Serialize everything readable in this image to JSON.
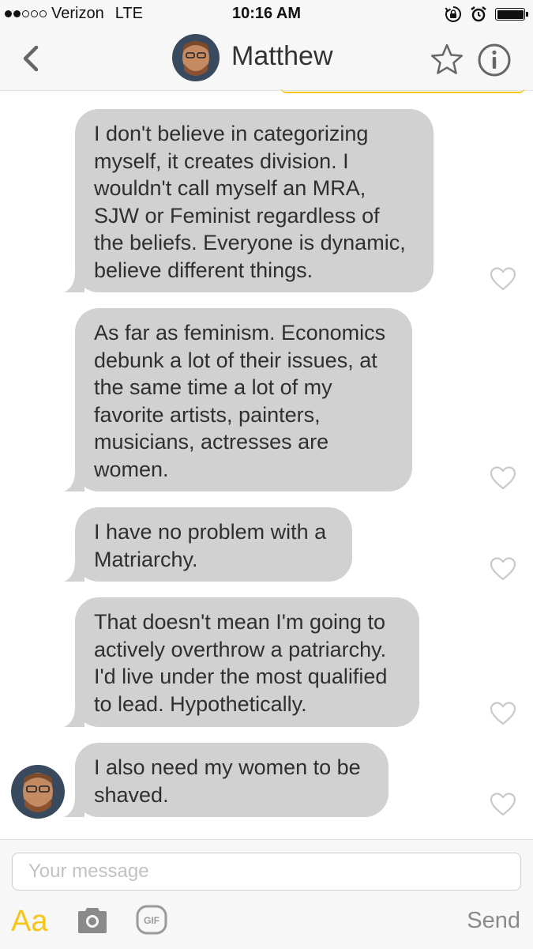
{
  "status_bar": {
    "carrier": "Verizon",
    "network": "LTE",
    "time": "10:16 AM",
    "signal_bars_filled": 2,
    "signal_bars_total": 5
  },
  "header": {
    "contact_name": "Matthew",
    "icons": [
      "chevron-left-icon",
      "star-icon",
      "info-icon"
    ],
    "accent_color": "#f5c518"
  },
  "messages": [
    {
      "text": "I don't believe in categorizing\nmyself, it creates division. I\nwouldn't call myself an MRA,\nSJW or Feminist regardless of\nthe beliefs. Everyone is dynamic,\nbelieve different things.",
      "liked": false
    },
    {
      "text": "As far as feminism. Economics\ndebunk a lot of their issues, at\nthe same time a lot of my\nfavorite artists, painters,\nmusicians, actresses are\nwomen.",
      "liked": false
    },
    {
      "text": "I have no problem with a\nMatriarchy.",
      "liked": false
    },
    {
      "text": "That doesn't mean I'm going to\nactively overthrow a patriarchy.\nI'd live under the most qualified\nto lead. Hypothetically.",
      "liked": false
    },
    {
      "text": "I also need my women to be\nshaved.",
      "liked": false
    }
  ],
  "composer": {
    "placeholder": "Your message",
    "value": "",
    "format_label": "Aa",
    "gif_label": "GIF",
    "send_label": "Send"
  },
  "colors": {
    "bubble": "#d1d1d1",
    "bar_background": "#f7f7f7",
    "accent": "#f5c518"
  }
}
